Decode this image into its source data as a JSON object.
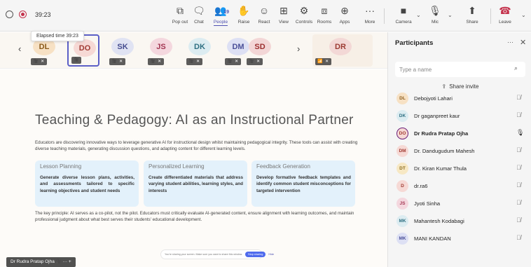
{
  "toolbar": {
    "timer": "39:23",
    "buttons": [
      {
        "id": "popout",
        "label": "Pop out",
        "icon": "⧉"
      },
      {
        "id": "chat",
        "label": "Chat",
        "icon": "🗨"
      },
      {
        "id": "people",
        "label": "People",
        "icon": "👥",
        "count": "19"
      },
      {
        "id": "raise",
        "label": "Raise",
        "icon": "✋"
      },
      {
        "id": "react",
        "label": "React",
        "icon": "☺"
      },
      {
        "id": "view",
        "label": "View",
        "icon": "⊞"
      },
      {
        "id": "controls",
        "label": "Controls",
        "icon": "⚙"
      },
      {
        "id": "rooms",
        "label": "Rooms",
        "icon": "⧈"
      },
      {
        "id": "apps",
        "label": "Apps",
        "icon": "⊕"
      },
      {
        "id": "more",
        "label": "More",
        "icon": "···"
      },
      {
        "id": "camera",
        "label": "Camera",
        "icon": "■"
      },
      {
        "id": "mic",
        "label": "Mic",
        "icon": "🎙"
      },
      {
        "id": "share",
        "label": "Share",
        "icon": "⬆"
      },
      {
        "id": "leave",
        "label": "Leave",
        "icon": "☎"
      }
    ]
  },
  "tooltip": "Elapsed time 39:23",
  "thumbnails": [
    {
      "initials": "DL",
      "bg": "#f7e1c4",
      "fg": "#8a5a1a",
      "status": "🎥 ✕"
    },
    {
      "initials": "DO",
      "bg": "#f6d9d5",
      "fg": "#a13b33",
      "status": "🎥",
      "selected": true
    },
    {
      "initials": "SK",
      "bg": "#e0e3f3",
      "fg": "#454c8f",
      "status": "🎥 ✕"
    },
    {
      "initials": "JS",
      "bg": "#f4d7de",
      "fg": "#a33753",
      "status": "🎥 ✕"
    },
    {
      "initials": "DK",
      "bg": "#dcecf1",
      "fg": "#2f6f82",
      "status": "🎥 ✕"
    },
    {
      "initials": "DM",
      "bg": "#dde0f4",
      "fg": "#4a4f98",
      "status": "🎥 ✕"
    },
    {
      "initials": "SD",
      "bg": "#f3d6d6",
      "fg": "#9c2f2f",
      "status": "🎥 ✕"
    },
    {
      "initials": "DR",
      "bg": "#f3d8d6",
      "fg": "#9c3b33",
      "status": "📶 ✕"
    }
  ],
  "slide": {
    "title": "Teaching & Pedagogy: AI as an Instructional Partner",
    "intro": "Educators are discovering innovative ways to leverage generative AI for instructional design whilst maintaining pedagogical integrity. These tools can assist with creating diverse teaching materials, generating discussion questions, and adapting content for different learning levels.",
    "cards": [
      {
        "title": "Lesson Planning",
        "body": "Generate diverse lesson plans, activities, and assessments tailored to specific learning objectives and student needs"
      },
      {
        "title": "Personalized Learning",
        "body": "Create differentiated materials that address varying student abilities, learning styles, and interests"
      },
      {
        "title": "Feedback Generation",
        "body": "Develop formative feedback templates and identify common student misconceptions for targeted intervention"
      }
    ],
    "footer": "The key principle: AI serves as a co-pilot, not the pilot. Educators must critically evaluate AI-generated content, ensure alignment with learning outcomes, and maintain professional judgment about what best serves their students' educational development."
  },
  "sharebar": {
    "text": "You're sharing your screen. Make sure you want to share this window.",
    "stop": "Stop sharing",
    "hide": "Hide"
  },
  "self_name": "Dr Rudra Pratap Ojha 🎥 ··· +",
  "panel": {
    "title": "Participants",
    "search_placeholder": "Type a name",
    "invite_label": "Share invite",
    "participants": [
      {
        "initials": "DL",
        "name": "Debojyoti Lahari",
        "bg": "#f7e1c4",
        "fg": "#8a5a1a",
        "mic": "muted"
      },
      {
        "initials": "DK",
        "name": "Dr gaganpreet kaur",
        "bg": "#dcecf1",
        "fg": "#2f6f82",
        "mic": "muted"
      },
      {
        "initials": "DO",
        "name": "Dr Rudra Pratap Ojha",
        "bg": "#f6d9d5",
        "fg": "#a13b33",
        "mic": "on",
        "selected": true
      },
      {
        "initials": "DM",
        "name": "Dr. Dandugudum Mahesh",
        "bg": "#f6d9d5",
        "fg": "#a13b33",
        "mic": "muted"
      },
      {
        "initials": "DT",
        "name": "Dr. Kiran Kumar Thula",
        "bg": "#f7e8c4",
        "fg": "#8a6a1a",
        "mic": "muted"
      },
      {
        "initials": "D",
        "name": "dr.ra6",
        "bg": "#f6d9d5",
        "fg": "#a13b33",
        "mic": "muted"
      },
      {
        "initials": "JS",
        "name": "Jyoti Sinha",
        "bg": "#f4d7de",
        "fg": "#a33753",
        "mic": "muted"
      },
      {
        "initials": "MK",
        "name": "Mahantesh Kodabagi",
        "bg": "#dcecf1",
        "fg": "#2f6f82",
        "mic": "muted"
      },
      {
        "initials": "MK",
        "name": "MANI KANDAN",
        "bg": "#dde0f4",
        "fg": "#4a4f98",
        "mic": "muted"
      }
    ]
  }
}
